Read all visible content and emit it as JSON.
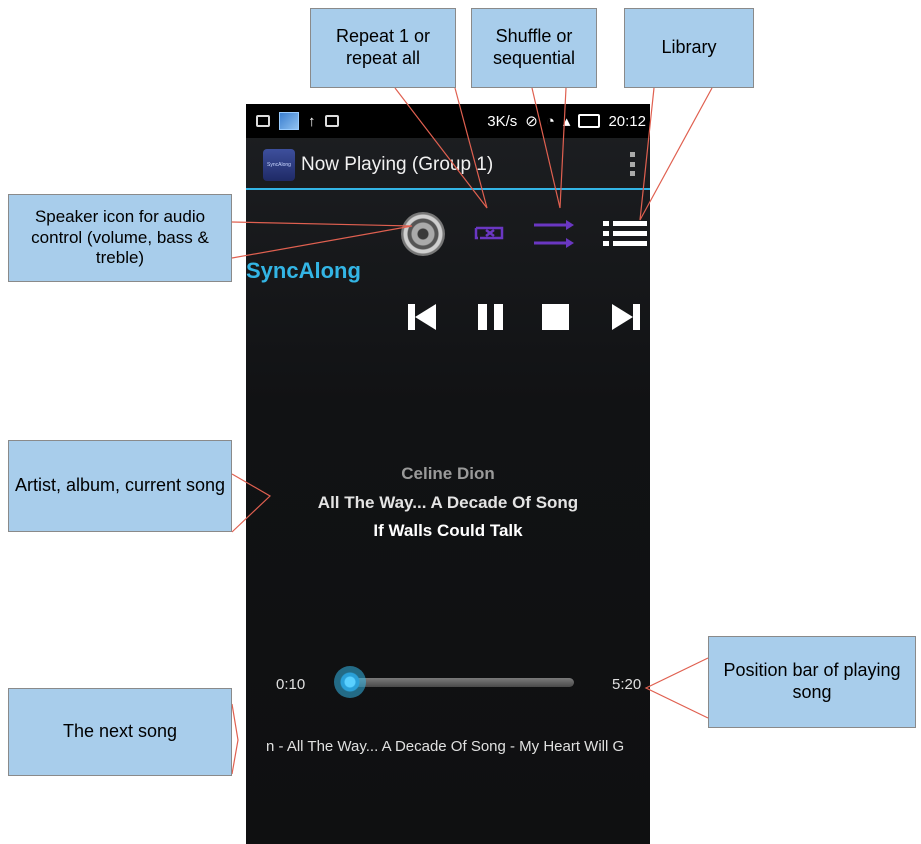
{
  "statusbar": {
    "speed": "3K/s",
    "time": "20:12"
  },
  "actionbar": {
    "icon_text": "SyncAlong",
    "title": "Now Playing (Group 1)"
  },
  "icons": {
    "speaker": "speaker-icon",
    "repeat": "repeat-icon",
    "shuffle": "shuffle-icon",
    "library": "list-icon",
    "prev": "skip-previous-icon",
    "pause": "pause-icon",
    "stop": "stop-icon",
    "next": "skip-next-icon"
  },
  "brand": "SyncAlong",
  "now_playing": {
    "artist": "Celine Dion",
    "album": "All The Way... A Decade Of Song",
    "song": "If Walls Could Talk"
  },
  "position": {
    "elapsed": "0:10",
    "total": "5:20",
    "progress_fraction": 0.03
  },
  "next_song": "n - All The Way... A Decade Of Song - My Heart Will G",
  "callouts": {
    "repeat": "Repeat 1 or repeat all",
    "shuffle": "Shuffle or sequential",
    "library": "Library",
    "speaker": "Speaker icon for audio control (volume, bass & treble)",
    "artist": "Artist, album, current song",
    "next": "The next song",
    "position": "Position bar of playing song"
  },
  "colors": {
    "accent": "#33b5e5",
    "icon_purple": "#6a37c2",
    "callout_fill": "#a8cdeb",
    "leader_line": "#e06050"
  }
}
